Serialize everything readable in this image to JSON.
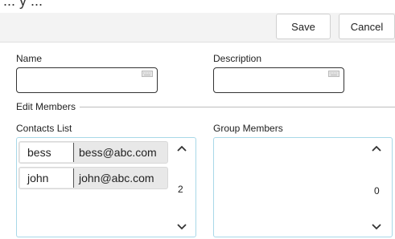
{
  "top_partial_text": "... y ...",
  "toolbar": {
    "save_label": "Save",
    "cancel_label": "Cancel"
  },
  "form": {
    "name_label": "Name",
    "name_value": "",
    "description_label": "Description",
    "description_value": ""
  },
  "edit_members": {
    "section_label": "Edit Members",
    "contacts": {
      "label": "Contacts List",
      "count": "2",
      "items": [
        {
          "name": "bess",
          "email": "bess@abc.com"
        },
        {
          "name": "john",
          "email": "john@abc.com"
        }
      ]
    },
    "group_members": {
      "label": "Group Members",
      "count": "0",
      "items": []
    }
  },
  "icons": {
    "scroll_up": "chevron-up-icon",
    "scroll_down": "chevron-down-icon",
    "keyboard": "keyboard-icon"
  },
  "colors": {
    "toolbar_bg": "#f3f3f3",
    "list_border": "#a8d8e8",
    "row_bg": "#e8e8e8"
  }
}
